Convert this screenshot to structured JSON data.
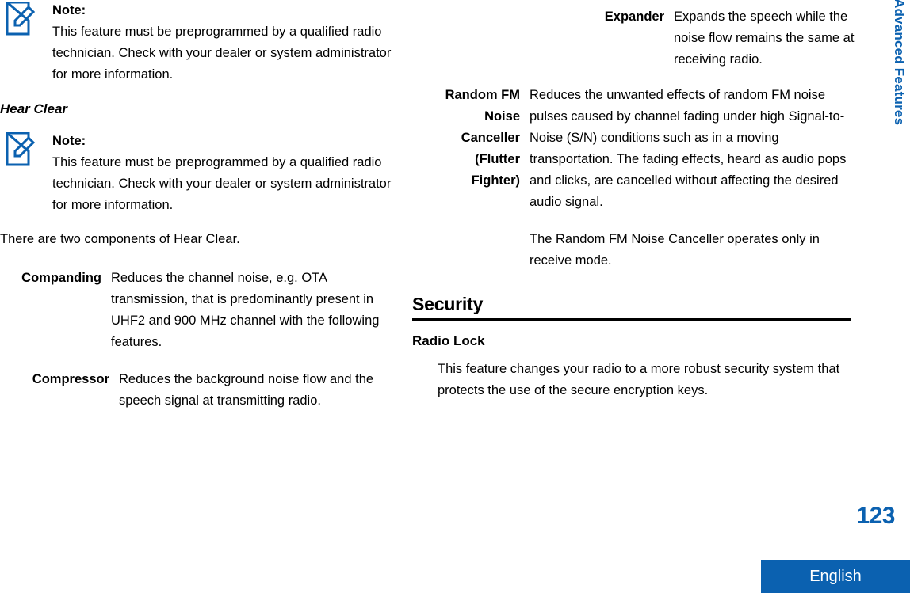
{
  "accent_color": "#0b61b0",
  "left_column": {
    "note_top": {
      "icon": "note-edit-icon",
      "title": "Note:",
      "text": "This feature must be preprogrammed by a qualified radio technician. Check with your dealer or system administrator for more information."
    },
    "hear_clear_heading": "Hear Clear",
    "note_hear_clear": {
      "icon": "note-edit-icon",
      "title": "Note:",
      "text": "This feature must be preprogrammed by a qualified radio technician. Check with your dealer or system administrator for more information."
    },
    "intro_paragraph": "There are two components of Hear Clear.",
    "companding": {
      "term": "Companding",
      "description": "Reduces the channel noise, e.g. OTA transmission, that is predominantly present in UHF2 and 900 MHz channel with the following features."
    },
    "compressor": {
      "term": "Compressor",
      "description": "Reduces the background noise flow and the speech signal at transmitting radio."
    }
  },
  "right_column": {
    "expander": {
      "term": "Expander",
      "description": "Expands the speech while the noise flow remains the same at receiving radio."
    },
    "random_fm": {
      "term": "Random FM\nNoise\nCanceller\n(Flutter\nFighter)",
      "description_1": "Reduces the unwanted effects of random FM noise pulses caused by channel fading under high Signal-to-Noise (S/N) conditions such as in a moving transportation. The fading effects, heard as audio pops and clicks, are cancelled without affecting the desired audio signal.",
      "description_2": "The Random FM Noise Canceller operates only in receive mode."
    },
    "security_heading": "Security",
    "radio_lock_heading": "Radio Lock",
    "radio_lock_text": "This feature changes your radio to a more robust security system that protects the use of the secure encryption keys."
  },
  "side_tab": {
    "label": "Advanced Features"
  },
  "footer": {
    "page_number": "123",
    "language": "English"
  }
}
